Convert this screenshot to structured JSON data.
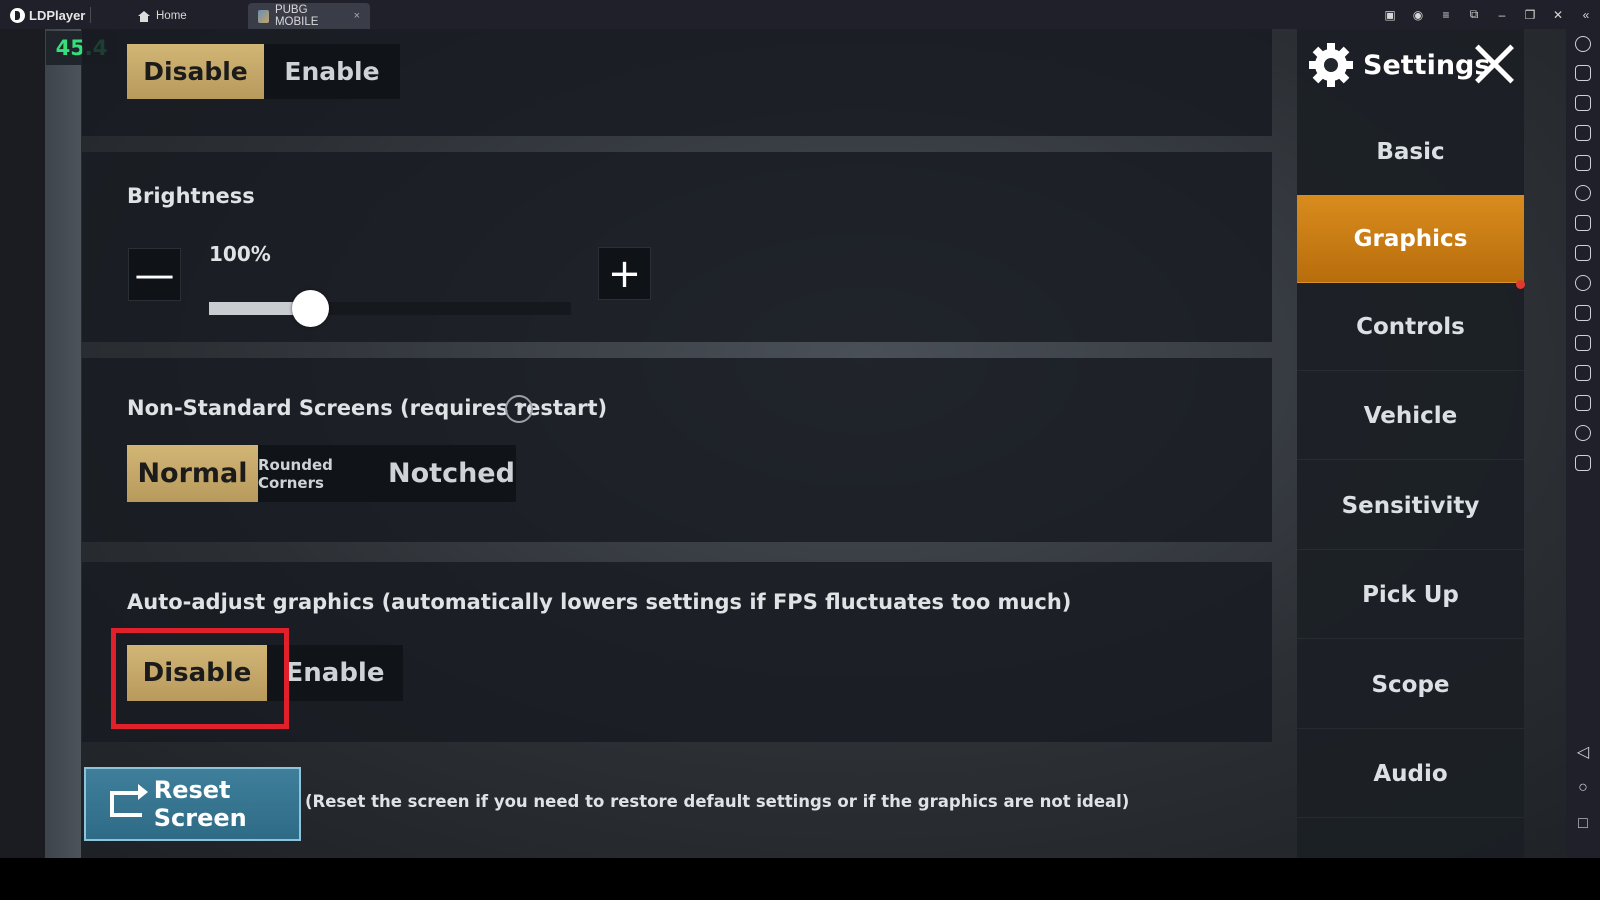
{
  "emulator": {
    "brand": "LDPlayer",
    "tabs": [
      {
        "label": "Home",
        "icon": "home-icon"
      },
      {
        "label": "PUBG MOBILE",
        "icon": "pubg-game-icon",
        "close": "×"
      }
    ],
    "window_controls": [
      "gamepad-icon",
      "account-icon",
      "menu-icon",
      "restore-window-icon",
      "minimize-icon",
      "maximize-icon",
      "close-icon",
      "collapse-sidebar-icon"
    ],
    "sidebar_icons": [
      "keyboard-mapping-icon",
      "keyboard-icon",
      "volume-up-icon",
      "volume-down-icon",
      "screenshot-icon",
      "sync-icon",
      "add-apk-icon",
      "apk-icon",
      "scissors-icon",
      "multi-instance-icon",
      "notes-icon",
      "shake-icon",
      "folder-icon",
      "location-icon",
      "rotate-icon"
    ],
    "nav_buttons": {
      "back": "◁",
      "home": "○",
      "recents": "□"
    }
  },
  "fps": "45.4",
  "top_toggle": {
    "disable": "Disable",
    "enable": "Enable",
    "selected": "Disable"
  },
  "brightness": {
    "label": "Brightness",
    "value_text": "100%",
    "level": 0.28,
    "minus": "—",
    "plus": "+"
  },
  "non_standard": {
    "label": "Non-Standard Screens (requires restart)",
    "help": "?",
    "options": [
      "Normal",
      "Rounded Corners",
      "Notched"
    ],
    "selected": "Normal"
  },
  "auto_adjust": {
    "label": "Auto-adjust graphics (automatically lowers settings if FPS fluctuates too much)",
    "disable": "Disable",
    "enable": "Enable",
    "selected": "Disable"
  },
  "reset": {
    "button": "Reset Screen",
    "note": "(Reset the screen if you need to restore default settings or if the graphics are not ideal)"
  },
  "menu": {
    "title": "Settings",
    "items": [
      "Basic",
      "Graphics",
      "Controls",
      "Vehicle",
      "Sensitivity",
      "Pick Up",
      "Scope",
      "Audio"
    ],
    "active": "Graphics"
  },
  "colors": {
    "accent_gold": "#c8ab6b",
    "menu_active_orange": "#cf7f16",
    "fps_green": "#35e07a",
    "highlight_red": "#e0212c",
    "reset_blue": "#357591"
  }
}
